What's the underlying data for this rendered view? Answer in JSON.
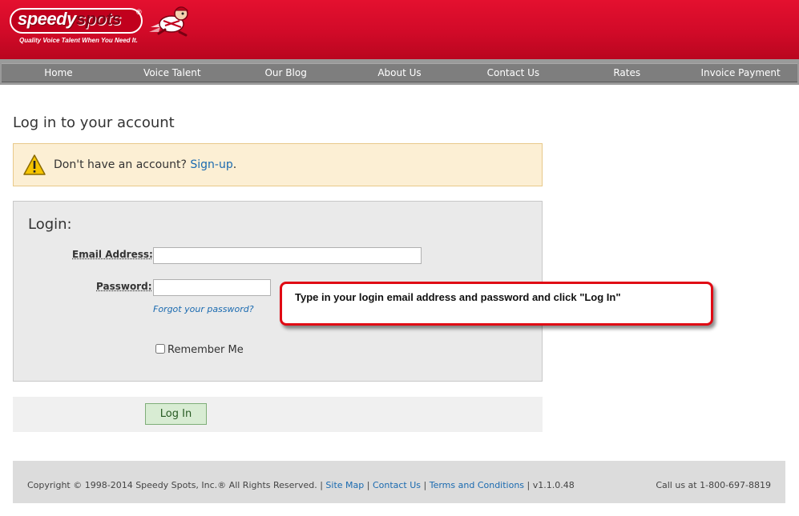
{
  "brand": {
    "logo_white": "speedy",
    "logo_red": "spots",
    "logo_reg": "®",
    "tagline": "Quality Voice Talent When You Need It.",
    "primary_color": "#d10a28",
    "nav_color": "#7e7e7e"
  },
  "nav": {
    "items": [
      {
        "label": "Home"
      },
      {
        "label": "Voice Talent"
      },
      {
        "label": "Our Blog"
      },
      {
        "label": "About Us"
      },
      {
        "label": "Contact Us"
      },
      {
        "label": "Rates"
      },
      {
        "label": "Invoice Payment"
      }
    ]
  },
  "page": {
    "title": "Log in to your account"
  },
  "alert": {
    "icon": "warning-icon",
    "text": "Don't have an account?",
    "link": "Sign-up",
    "suffix": "."
  },
  "login": {
    "heading": "Login:",
    "email_label": "Email Address:",
    "email_value": "",
    "password_label": "Password:",
    "password_value": "",
    "forgot_link": "Forgot your password?",
    "remember_label": "Remember Me",
    "remember_checked": false,
    "submit_label": "Log In"
  },
  "callout": {
    "text": "Type in your login email address and password and click \"Log In\""
  },
  "footer": {
    "copyright": "Copyright © 1998-2014 Speedy Spots, Inc.® All Rights Reserved.",
    "links": [
      "Site Map",
      "Contact Us",
      "Terms and Conditions"
    ],
    "version": "v1.1.0.48",
    "phone": "Call us at 1-800-697-8819"
  }
}
